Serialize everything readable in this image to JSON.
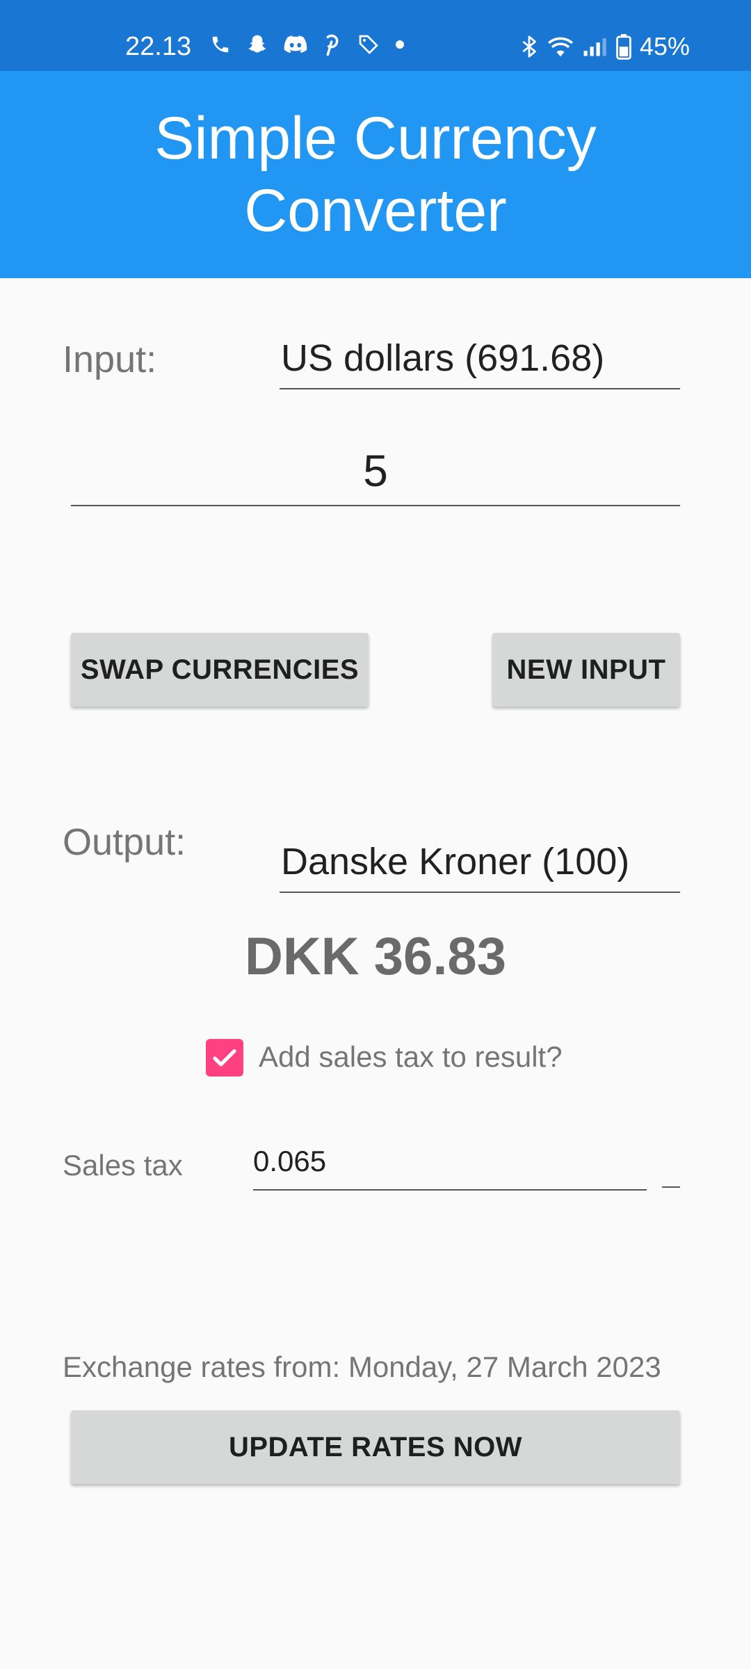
{
  "status_bar": {
    "time": "22.13",
    "battery": "45%",
    "left_icons": [
      "phone-icon",
      "snapchat-icon",
      "discord-icon",
      "pinterest-icon",
      "tag-icon",
      "dot-icon"
    ],
    "right_icons": [
      "bluetooth-icon",
      "wifi-icon",
      "signal-icon",
      "battery-icon"
    ]
  },
  "app_bar": {
    "title": "Simple Currency Converter",
    "color": "#2196f3"
  },
  "input": {
    "label": "Input:",
    "currency": "US dollars (691.68)",
    "amount": "5"
  },
  "buttons": {
    "swap": "SWAP CURRENCIES",
    "new_input": "NEW INPUT",
    "update_rates": "UPDATE RATES NOW"
  },
  "output": {
    "label": "Output:",
    "currency": "Danske Kroner (100)",
    "result": "DKK 36.83"
  },
  "sales_tax": {
    "checkbox_label": "Add sales tax to result?",
    "checked": true,
    "checkbox_color": "#ff4081",
    "label": "Sales tax",
    "value": "0.065"
  },
  "rates": {
    "text": "Exchange rates from: Monday, 27 March 2023"
  }
}
